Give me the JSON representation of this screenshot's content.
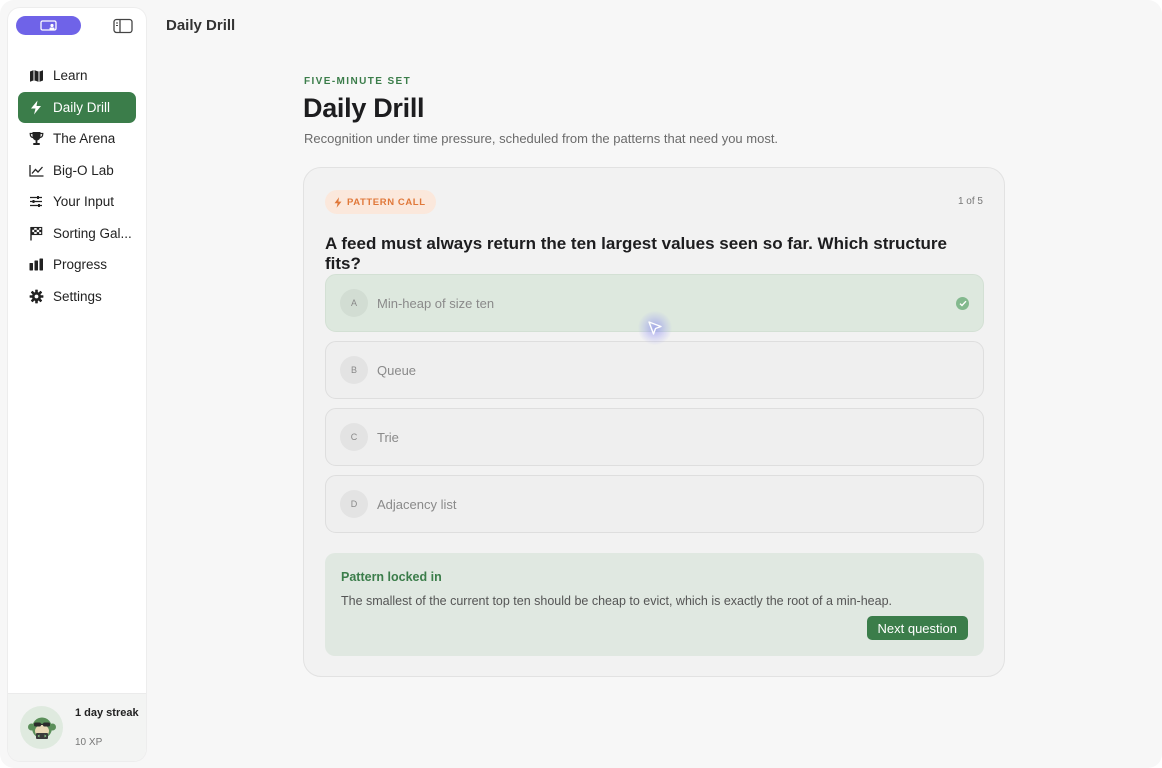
{
  "app": {
    "title": "Daily Drill"
  },
  "sidebar": {
    "items": [
      {
        "label": "Learn",
        "icon": "map-icon",
        "active": false
      },
      {
        "label": "Daily Drill",
        "icon": "bolt-icon",
        "active": true
      },
      {
        "label": "The Arena",
        "icon": "trophy-icon",
        "active": false
      },
      {
        "label": "Big-O Lab",
        "icon": "line-chart-icon",
        "active": false
      },
      {
        "label": "Your Input",
        "icon": "sliders-icon",
        "active": false
      },
      {
        "label": "Sorting Gal...",
        "icon": "checkered-flag-icon",
        "active": false
      },
      {
        "label": "Progress",
        "icon": "bar-chart-icon",
        "active": false
      },
      {
        "label": "Settings",
        "icon": "gear-icon",
        "active": false
      }
    ],
    "footer": {
      "streak": "1 day streak",
      "xp": "10 XP"
    }
  },
  "main": {
    "eyebrow": "FIVE-MINUTE SET",
    "title": "Daily Drill",
    "subtitle": "Recognition under time pressure, scheduled from the patterns that need you most.",
    "card": {
      "tag": "PATTERN CALL",
      "counter": "1 of 5",
      "question": "A feed must always return the ten largest values seen so far. Which structure fits?",
      "options": [
        {
          "letter": "A",
          "text": "Min-heap of size ten",
          "correct": true
        },
        {
          "letter": "B",
          "text": "Queue",
          "correct": false
        },
        {
          "letter": "C",
          "text": "Trie",
          "correct": false
        },
        {
          "letter": "D",
          "text": "Adjacency list",
          "correct": false
        }
      ],
      "feedback": {
        "title": "Pattern locked in",
        "text": "The smallest of the current top ten should be cheap to evict, which is exactly the root of a min-heap.",
        "button": "Next question"
      }
    }
  },
  "colors": {
    "accent_green": "#3b7d4a",
    "brand_purple": "#6f63e8",
    "tag_orange": "#e0783a"
  }
}
